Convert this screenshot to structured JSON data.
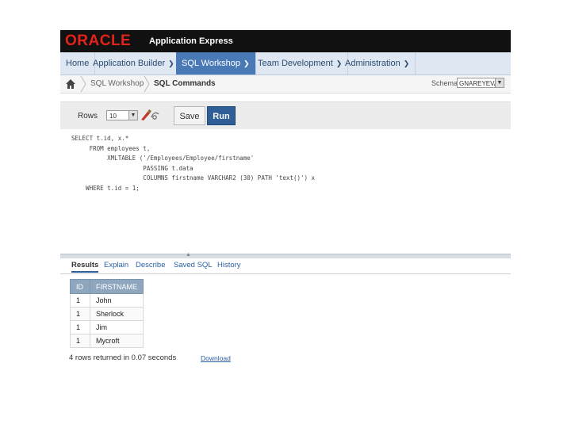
{
  "header": {
    "logo_text": "ORACLE",
    "app_title": "Application Express"
  },
  "nav": {
    "tabs": [
      {
        "label": "Home",
        "dropdown": false,
        "active": false
      },
      {
        "label": "Application Builder",
        "dropdown": true,
        "active": false
      },
      {
        "label": "SQL Workshop",
        "dropdown": true,
        "active": true
      },
      {
        "label": "Team Development",
        "dropdown": true,
        "active": false
      },
      {
        "label": "Administration",
        "dropdown": true,
        "active": false
      }
    ]
  },
  "breadcrumb": {
    "items": [
      "SQL Workshop",
      "SQL Commands"
    ],
    "schema_label": "Schema",
    "schema_value": "GNAREYEVA"
  },
  "toolbar": {
    "rows_label": "Rows",
    "rows_value": "10",
    "save_label": "Save",
    "run_label": "Run"
  },
  "editor": {
    "code": "SELECT t.id, x.*\n     FROM employees t,\n          XMLTABLE ('/Employees/Employee/firstname'\n                    PASSING t.data\n                    COLUMNS firstname VARCHAR2 (30) PATH 'text()') x\n    WHERE t.id = 1;"
  },
  "result_tabs": [
    {
      "label": "Results",
      "active": true
    },
    {
      "label": "Explain",
      "active": false
    },
    {
      "label": "Describe",
      "active": false
    },
    {
      "label": "Saved SQL",
      "active": false
    },
    {
      "label": "History",
      "active": false
    }
  ],
  "results": {
    "columns": [
      "ID",
      "FIRSTNAME"
    ],
    "rows": [
      [
        "1",
        "John"
      ],
      [
        "1",
        "Sherlock"
      ],
      [
        "1",
        "Jim"
      ],
      [
        "1",
        "Mycroft"
      ]
    ],
    "summary": "4 rows returned in 0.07 seconds",
    "download_label": "Download"
  },
  "colors": {
    "accent": "#4a7ab5",
    "run_button": "#2f5f96",
    "logo_red": "#e2231a",
    "table_header": "#8fa6bf"
  }
}
